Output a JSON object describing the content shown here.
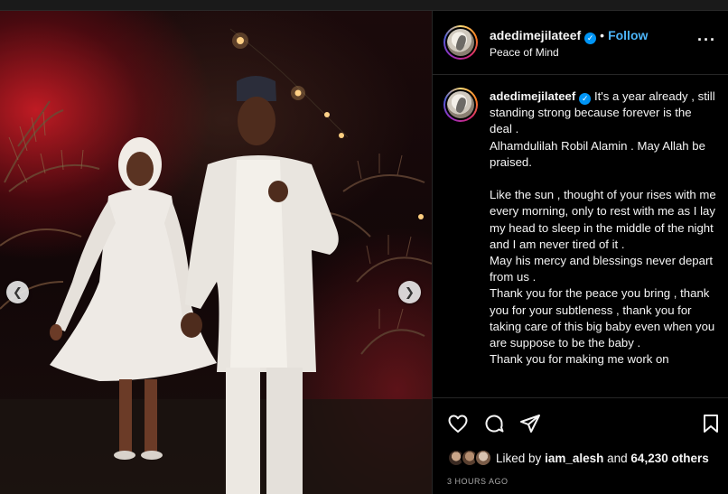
{
  "post": {
    "username": "adedimejilateef",
    "follow_label": "Follow",
    "location": "Peace of Mind",
    "caption_lines": [
      "It's a year already , still standing strong because forever is the deal .",
      "Alhamdulilah Robil Alamin . May Allah be praised.",
      "",
      "Like the sun , thought of your rises with me every morning, only to rest with me as I lay my head to sleep in the middle of the night and I am never tired of it .",
      "May his mercy and blessings never depart from us .",
      "Thank you for the peace you bring , thank you for your subtleness , thank you for taking care of this big baby even when you are suppose to be the baby .",
      "Thank you for making me work on"
    ],
    "liked_by_prefix": "Liked by",
    "liked_by_user": "iam_alesh",
    "liked_by_and": "and",
    "liked_by_others": "64,230 others",
    "timestamp": "3 HOURS AGO"
  },
  "icons": {
    "verified": "verified-badge-icon",
    "more": "more-options-icon",
    "like": "heart-icon",
    "comment": "comment-icon",
    "share": "share-icon",
    "save": "bookmark-icon",
    "prev": "chevron-left-icon",
    "next": "chevron-right-icon"
  },
  "colors": {
    "accent_blue": "#0095f6",
    "follow_blue": "#4cb5f9",
    "background": "#000000",
    "text": "#f5f5f5",
    "muted": "#a8a8a8"
  }
}
